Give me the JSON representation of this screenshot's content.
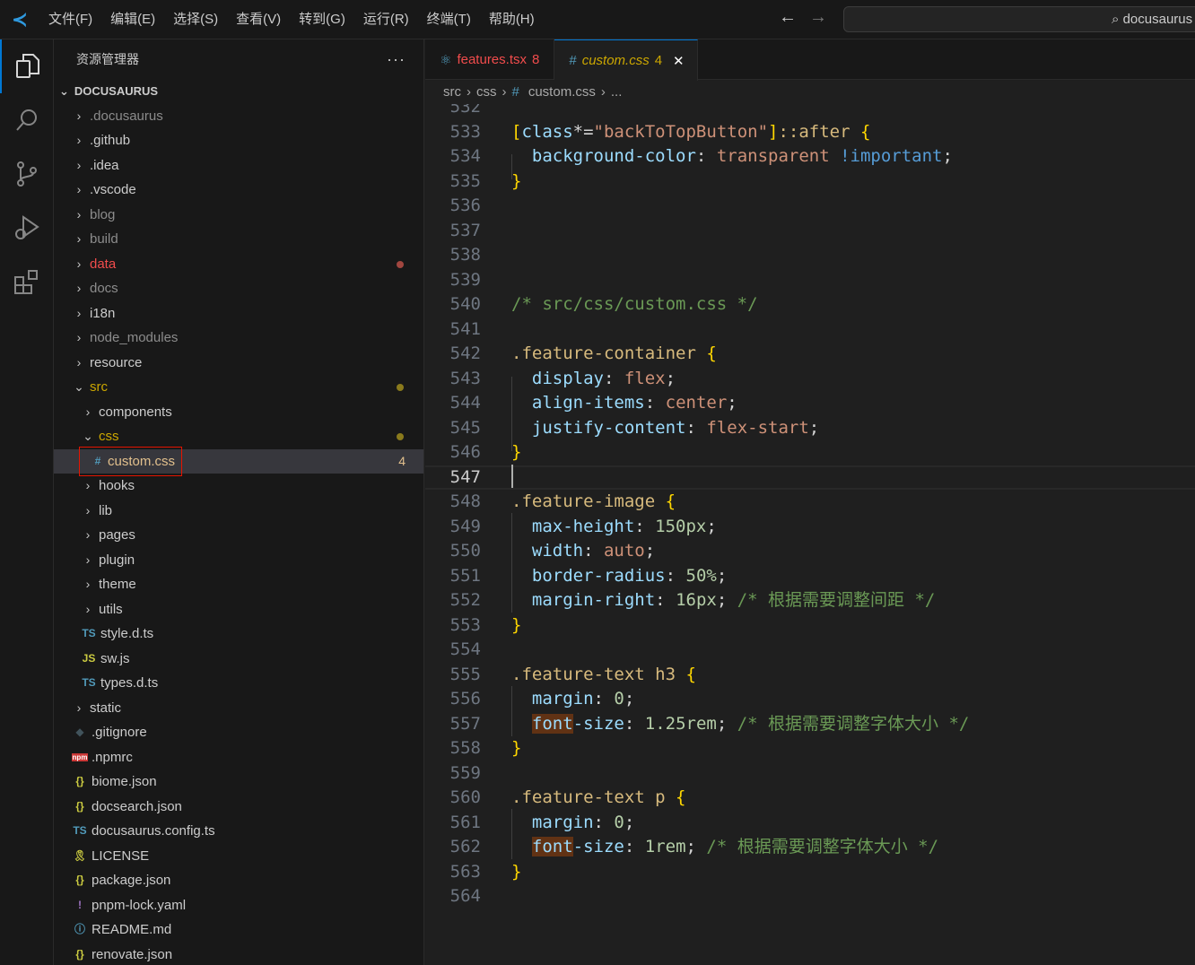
{
  "titlebar": {
    "menus": [
      "文件(F)",
      "编辑(E)",
      "选择(S)",
      "查看(V)",
      "转到(G)",
      "运行(R)",
      "终端(T)",
      "帮助(H)"
    ],
    "search": "docusaurus"
  },
  "activity": [
    "explorer-icon",
    "search-icon",
    "source-control-icon",
    "run-debug-icon",
    "extensions-icon"
  ],
  "sidebar": {
    "title": "资源管理器",
    "more": "···",
    "root": "DOCUSAURUS",
    "items": [
      {
        "label": ".docusaurus",
        "indent": 0,
        "kind": "folder",
        "color": "#8c8c8c"
      },
      {
        "label": ".github",
        "indent": 0,
        "kind": "folder",
        "color": "#cccccc"
      },
      {
        "label": ".idea",
        "indent": 0,
        "kind": "folder",
        "color": "#cccccc"
      },
      {
        "label": ".vscode",
        "indent": 0,
        "kind": "folder",
        "color": "#cccccc"
      },
      {
        "label": "blog",
        "indent": 0,
        "kind": "folder",
        "color": "#8c8c8c"
      },
      {
        "label": "build",
        "indent": 0,
        "kind": "folder",
        "color": "#8c8c8c"
      },
      {
        "label": "data",
        "indent": 0,
        "kind": "folder",
        "color": "#f14c4c",
        "dot": "#a1463f"
      },
      {
        "label": "docs",
        "indent": 0,
        "kind": "folder",
        "color": "#8c8c8c"
      },
      {
        "label": "i18n",
        "indent": 0,
        "kind": "folder",
        "color": "#cccccc"
      },
      {
        "label": "node_modules",
        "indent": 0,
        "kind": "folder",
        "color": "#8c8c8c"
      },
      {
        "label": "resource",
        "indent": 0,
        "kind": "folder",
        "color": "#cccccc"
      },
      {
        "label": "src",
        "indent": 0,
        "kind": "open",
        "color": "#cca700",
        "dot": "#8a7a1c"
      },
      {
        "label": "components",
        "indent": 1,
        "kind": "folder",
        "color": "#cccccc"
      },
      {
        "label": "css",
        "indent": 1,
        "kind": "open",
        "color": "#cca700",
        "dot": "#8a7a1c"
      },
      {
        "label": "custom.css",
        "indent": 2,
        "kind": "file",
        "icon": "#",
        "iconColor": "#519aba",
        "color": "#e2c08d",
        "badge": "4",
        "selected": true
      },
      {
        "label": "hooks",
        "indent": 1,
        "kind": "folder",
        "color": "#cccccc"
      },
      {
        "label": "lib",
        "indent": 1,
        "kind": "folder",
        "color": "#cccccc"
      },
      {
        "label": "pages",
        "indent": 1,
        "kind": "folder",
        "color": "#cccccc"
      },
      {
        "label": "plugin",
        "indent": 1,
        "kind": "folder",
        "color": "#cccccc"
      },
      {
        "label": "theme",
        "indent": 1,
        "kind": "folder",
        "color": "#cccccc"
      },
      {
        "label": "utils",
        "indent": 1,
        "kind": "folder",
        "color": "#cccccc"
      },
      {
        "label": "style.d.ts",
        "indent": 1,
        "kind": "file",
        "icon": "TS",
        "iconColor": "#519aba",
        "color": "#cccccc"
      },
      {
        "label": "sw.js",
        "indent": 1,
        "kind": "file",
        "icon": "JS",
        "iconColor": "#cbcb41",
        "color": "#cccccc"
      },
      {
        "label": "types.d.ts",
        "indent": 1,
        "kind": "file",
        "icon": "TS",
        "iconColor": "#519aba",
        "color": "#cccccc"
      },
      {
        "label": "static",
        "indent": 0,
        "kind": "folder",
        "color": "#cccccc"
      },
      {
        "label": ".gitignore",
        "indent": 0,
        "kind": "file",
        "icon": "◆",
        "iconColor": "#41535b",
        "color": "#cccccc"
      },
      {
        "label": ".npmrc",
        "indent": 0,
        "kind": "file",
        "icon": "npm",
        "iconColor": "#cb3837",
        "color": "#cccccc"
      },
      {
        "label": "biome.json",
        "indent": 0,
        "kind": "file",
        "icon": "{}",
        "iconColor": "#cbcb41",
        "color": "#cccccc"
      },
      {
        "label": "docsearch.json",
        "indent": 0,
        "kind": "file",
        "icon": "{}",
        "iconColor": "#cbcb41",
        "color": "#cccccc"
      },
      {
        "label": "docusaurus.config.ts",
        "indent": 0,
        "kind": "file",
        "icon": "TS",
        "iconColor": "#519aba",
        "color": "#cccccc"
      },
      {
        "label": "LICENSE",
        "indent": 0,
        "kind": "file",
        "icon": "🎗",
        "iconColor": "#cbcb41",
        "color": "#cccccc"
      },
      {
        "label": "package.json",
        "indent": 0,
        "kind": "file",
        "icon": "{}",
        "iconColor": "#cbcb41",
        "color": "#cccccc"
      },
      {
        "label": "pnpm-lock.yaml",
        "indent": 0,
        "kind": "file",
        "icon": "!",
        "iconColor": "#a074c4",
        "color": "#cccccc"
      },
      {
        "label": "README.md",
        "indent": 0,
        "kind": "file",
        "icon": "ⓘ",
        "iconColor": "#519aba",
        "color": "#cccccc"
      },
      {
        "label": "renovate.json",
        "indent": 0,
        "kind": "file",
        "icon": "{}",
        "iconColor": "#cbcb41",
        "color": "#cccccc"
      }
    ]
  },
  "tabs": [
    {
      "label": "features.tsx",
      "count": "8",
      "icon": "⚛",
      "iconColor": "#519aba",
      "color": "#f14c4c",
      "active": false
    },
    {
      "label": "custom.css",
      "count": "4",
      "icon": "#",
      "iconColor": "#519aba",
      "color": "#cca700",
      "active": true,
      "close": "✕"
    }
  ],
  "breadcrumb": {
    "parts": [
      "src",
      "css",
      "custom.css",
      "..."
    ],
    "sep": "›",
    "fileIcon": "#"
  },
  "editor": {
    "first_partial": "532",
    "current_line": 547,
    "lines": [
      {
        "n": 533,
        "t": [
          [
            "br",
            "["
          ],
          [
            "prop",
            "class"
          ],
          [
            "p",
            "*="
          ],
          [
            "val",
            "\"backToTopButton\""
          ],
          [
            "br",
            "]"
          ],
          [
            "sel",
            "::after "
          ],
          [
            "br",
            "{"
          ]
        ]
      },
      {
        "n": 534,
        "t": [
          [
            "p",
            "  "
          ],
          [
            "prop",
            "background-color"
          ],
          [
            "p",
            ": "
          ],
          [
            "val",
            "transparent "
          ],
          [
            "imp",
            "!important"
          ],
          [
            "p",
            ";"
          ]
        ]
      },
      {
        "n": 535,
        "t": [
          [
            "br",
            "}"
          ]
        ]
      },
      {
        "n": 536,
        "t": []
      },
      {
        "n": 537,
        "t": []
      },
      {
        "n": 538,
        "t": []
      },
      {
        "n": 539,
        "t": []
      },
      {
        "n": 540,
        "t": [
          [
            "com",
            "/* src/css/custom.css */"
          ]
        ]
      },
      {
        "n": 541,
        "t": []
      },
      {
        "n": 542,
        "t": [
          [
            "sel",
            ".feature-container "
          ],
          [
            "br",
            "{"
          ]
        ]
      },
      {
        "n": 543,
        "t": [
          [
            "p",
            "  "
          ],
          [
            "prop",
            "display"
          ],
          [
            "p",
            ": "
          ],
          [
            "val",
            "flex"
          ],
          [
            "p",
            ";"
          ]
        ]
      },
      {
        "n": 544,
        "t": [
          [
            "p",
            "  "
          ],
          [
            "prop",
            "align-items"
          ],
          [
            "p",
            ": "
          ],
          [
            "val",
            "center"
          ],
          [
            "p",
            ";"
          ]
        ]
      },
      {
        "n": 545,
        "t": [
          [
            "p",
            "  "
          ],
          [
            "prop",
            "justify-content"
          ],
          [
            "p",
            ": "
          ],
          [
            "val",
            "flex-start"
          ],
          [
            "p",
            ";"
          ]
        ]
      },
      {
        "n": 546,
        "t": [
          [
            "br",
            "}"
          ]
        ]
      },
      {
        "n": 547,
        "t": []
      },
      {
        "n": 548,
        "t": [
          [
            "sel",
            ".feature-image "
          ],
          [
            "br",
            "{"
          ]
        ]
      },
      {
        "n": 549,
        "t": [
          [
            "p",
            "  "
          ],
          [
            "prop",
            "max-height"
          ],
          [
            "p",
            ": "
          ],
          [
            "num",
            "150px"
          ],
          [
            "p",
            ";"
          ]
        ]
      },
      {
        "n": 550,
        "t": [
          [
            "p",
            "  "
          ],
          [
            "prop",
            "width"
          ],
          [
            "p",
            ": "
          ],
          [
            "val",
            "auto"
          ],
          [
            "p",
            ";"
          ]
        ]
      },
      {
        "n": 551,
        "t": [
          [
            "p",
            "  "
          ],
          [
            "prop",
            "border-radius"
          ],
          [
            "p",
            ": "
          ],
          [
            "num",
            "50%"
          ],
          [
            "p",
            ";"
          ]
        ]
      },
      {
        "n": 552,
        "t": [
          [
            "p",
            "  "
          ],
          [
            "prop",
            "margin-right"
          ],
          [
            "p",
            ": "
          ],
          [
            "num",
            "16px"
          ],
          [
            "p",
            "; "
          ],
          [
            "com",
            "/* 根据需要调整间距 */"
          ]
        ]
      },
      {
        "n": 553,
        "t": [
          [
            "br",
            "}"
          ]
        ]
      },
      {
        "n": 554,
        "t": []
      },
      {
        "n": 555,
        "t": [
          [
            "sel",
            ".feature-text h3 "
          ],
          [
            "br",
            "{"
          ]
        ]
      },
      {
        "n": 556,
        "t": [
          [
            "p",
            "  "
          ],
          [
            "prop",
            "margin"
          ],
          [
            "p",
            ": "
          ],
          [
            "num",
            "0"
          ],
          [
            "p",
            ";"
          ]
        ]
      },
      {
        "n": 557,
        "t": [
          [
            "p",
            "  "
          ],
          [
            "hl",
            "font"
          ],
          [
            "prop",
            "-size"
          ],
          [
            "p",
            ": "
          ],
          [
            "num",
            "1.25rem"
          ],
          [
            "p",
            "; "
          ],
          [
            "com",
            "/* 根据需要调整字体大小 */"
          ]
        ]
      },
      {
        "n": 558,
        "t": [
          [
            "br",
            "}"
          ]
        ]
      },
      {
        "n": 559,
        "t": []
      },
      {
        "n": 560,
        "t": [
          [
            "sel",
            ".feature-text p "
          ],
          [
            "br",
            "{"
          ]
        ]
      },
      {
        "n": 561,
        "t": [
          [
            "p",
            "  "
          ],
          [
            "prop",
            "margin"
          ],
          [
            "p",
            ": "
          ],
          [
            "num",
            "0"
          ],
          [
            "p",
            ";"
          ]
        ]
      },
      {
        "n": 562,
        "t": [
          [
            "p",
            "  "
          ],
          [
            "hl",
            "font"
          ],
          [
            "prop",
            "-size"
          ],
          [
            "p",
            ": "
          ],
          [
            "num",
            "1rem"
          ],
          [
            "p",
            "; "
          ],
          [
            "com",
            "/* 根据需要调整字体大小 */"
          ]
        ]
      },
      {
        "n": 563,
        "t": [
          [
            "br",
            "}"
          ]
        ]
      },
      {
        "n": 564,
        "t": []
      }
    ]
  }
}
